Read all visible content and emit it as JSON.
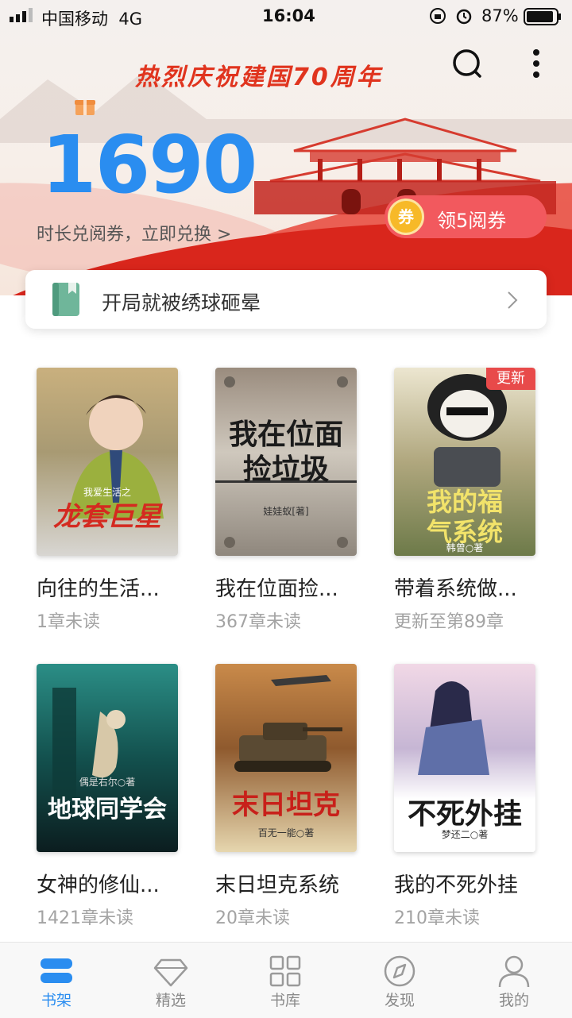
{
  "status_bar": {
    "carrier": "中国移动",
    "network": "4G",
    "time": "16:04",
    "battery": "87%"
  },
  "banner": {
    "title": "热烈庆祝建国70周年",
    "points": "1690",
    "subtitle": "时长兑阅券，立即兑换 >",
    "coupon_icon": "券",
    "coupon_label": "领5阅券"
  },
  "recent_reading": {
    "title": "开局就被绣球砸晕"
  },
  "books": [
    {
      "title": "向往的生活...",
      "status": "1章未读",
      "cover_title": "龙套巨星",
      "cover_author": "我爱生活之",
      "badge": ""
    },
    {
      "title": "我在位面捡...",
      "status": "367章未读",
      "cover_title": "我在位面捡垃圾",
      "cover_author": "娃娃蚁[著]",
      "badge": ""
    },
    {
      "title": "带着系统做...",
      "status": "更新至第89章",
      "cover_title": "我的福气系统",
      "cover_author": "韩曾○著",
      "badge": "更新"
    },
    {
      "title": "女神的修仙...",
      "status": "1421章未读",
      "cover_title": "地球同学会",
      "cover_author": "偶是右尔○著",
      "badge": ""
    },
    {
      "title": "末日坦克系统",
      "status": "20章未读",
      "cover_title": "末日坦克",
      "cover_author": "百无一能○著",
      "badge": ""
    },
    {
      "title": "我的不死外挂",
      "status": "210章未读",
      "cover_title": "不死外挂",
      "cover_author": "梦还二○著",
      "badge": ""
    }
  ],
  "tabs": [
    {
      "label": "书架",
      "icon": "bookshelf-icon",
      "active": true
    },
    {
      "label": "精选",
      "icon": "diamond-icon",
      "active": false
    },
    {
      "label": "书库",
      "icon": "grid-icon",
      "active": false
    },
    {
      "label": "发现",
      "icon": "compass-icon",
      "active": false
    },
    {
      "label": "我的",
      "icon": "user-icon",
      "active": false
    }
  ],
  "colors": {
    "accent": "#2a8df0",
    "banner_red": "#e0341e",
    "coupon": "#f2595e",
    "badge": "#e84a4a"
  }
}
